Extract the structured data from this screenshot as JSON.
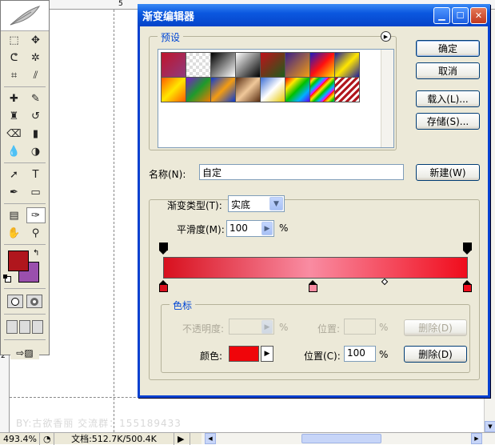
{
  "ruler": {
    "top_num": "5",
    "left_num": "2"
  },
  "watermark": "BY:古欲香丽 交流群：155189433",
  "toolbox": {
    "tools": [
      [
        "marquee-tool",
        "move-tool"
      ],
      [
        "lasso-tool",
        "magic-wand-tool"
      ],
      [
        "crop-tool",
        "slice-tool"
      ],
      [
        "healing-brush-tool",
        "brush-tool"
      ],
      [
        "clone-stamp-tool",
        "history-brush-tool"
      ],
      [
        "eraser-tool",
        "gradient-tool"
      ],
      [
        "blur-tool",
        "dodge-tool"
      ],
      [
        "path-selection-tool",
        "type-tool"
      ],
      [
        "pen-tool",
        "shape-tool"
      ],
      [
        "notes-tool",
        "eyedropper-tool"
      ],
      [
        "hand-tool",
        "zoom-tool"
      ]
    ],
    "type_glyph": "T",
    "foreground_color": "#b0161d",
    "background_color": "#9a4fad"
  },
  "dialog": {
    "title": "渐变编辑器",
    "presets_label": "预设",
    "presets": [
      "linear-gradient(135deg,#c0142b,#8f3a7e)",
      "repeating-conic-gradient(#ddd 0 25%,#fff 0 50%) 0 0/8px 8px,linear-gradient(135deg,#b0161d,transparent)",
      "linear-gradient(135deg,#000,#fff)",
      "linear-gradient(135deg,#fff,#000)",
      "linear-gradient(135deg,#c01019,#1d5e1c)",
      "linear-gradient(135deg,#3a1f8a,#f39c12)",
      "linear-gradient(135deg,#1b1bc4,#ff1010,#ffe600)",
      "linear-gradient(135deg,#1d1d9d,#ffe600,#1d1d9d)",
      "linear-gradient(135deg,#ff5b00,#ffe600,#ff5b00)",
      "linear-gradient(135deg,#7a1ccc,#1e9a2c,#f17a00)",
      "linear-gradient(135deg,#0a3ad0,#f39c12,#0a3ad0)",
      "linear-gradient(135deg,#5a2e12,#f0c89a,#5a2e12)",
      "linear-gradient(135deg,#3a6dd4,#fff,#e6c700)",
      "linear-gradient(135deg,#ff0000,#ffe600,#00c000,#00b0ff,#6000ff)",
      "repeating-linear-gradient(135deg,#ff0000,#ffe600 4px,#00c000 8px,#00b0ff 12px,#ff00ff 16px)",
      "repeating-linear-gradient(135deg,#b0161d 0 3px,#fff 3px 6px)"
    ],
    "buttons": {
      "ok": "确定",
      "cancel": "取消",
      "load": "载入(L)...",
      "save": "存储(S)...",
      "new": "新建(W)"
    },
    "name_label": "名称(N):",
    "name_value": "自定",
    "gradient_type_label": "渐变类型(T):",
    "gradient_type_value": "实底",
    "smoothness_label": "平滑度(M):",
    "smoothness_value": "100",
    "smoothness_unit": "%",
    "gradient_colors": [
      "#d8101e",
      "#f98ca2",
      "#f00c1c"
    ],
    "color_stops_label": "色标",
    "opacity_label": "不透明度:",
    "opacity_unit": "%",
    "opacity_location_label": "位置:",
    "opacity_location_unit": "%",
    "delete_disabled": "删除(D)",
    "color_label": "颜色:",
    "color_value": "#f0050a",
    "location_label": "位置(C):",
    "location_value": "100",
    "location_unit": "%",
    "delete": "删除(D)"
  },
  "status": {
    "zoom": "493.4%",
    "doc_info": "文档:512.7K/500.4K"
  }
}
